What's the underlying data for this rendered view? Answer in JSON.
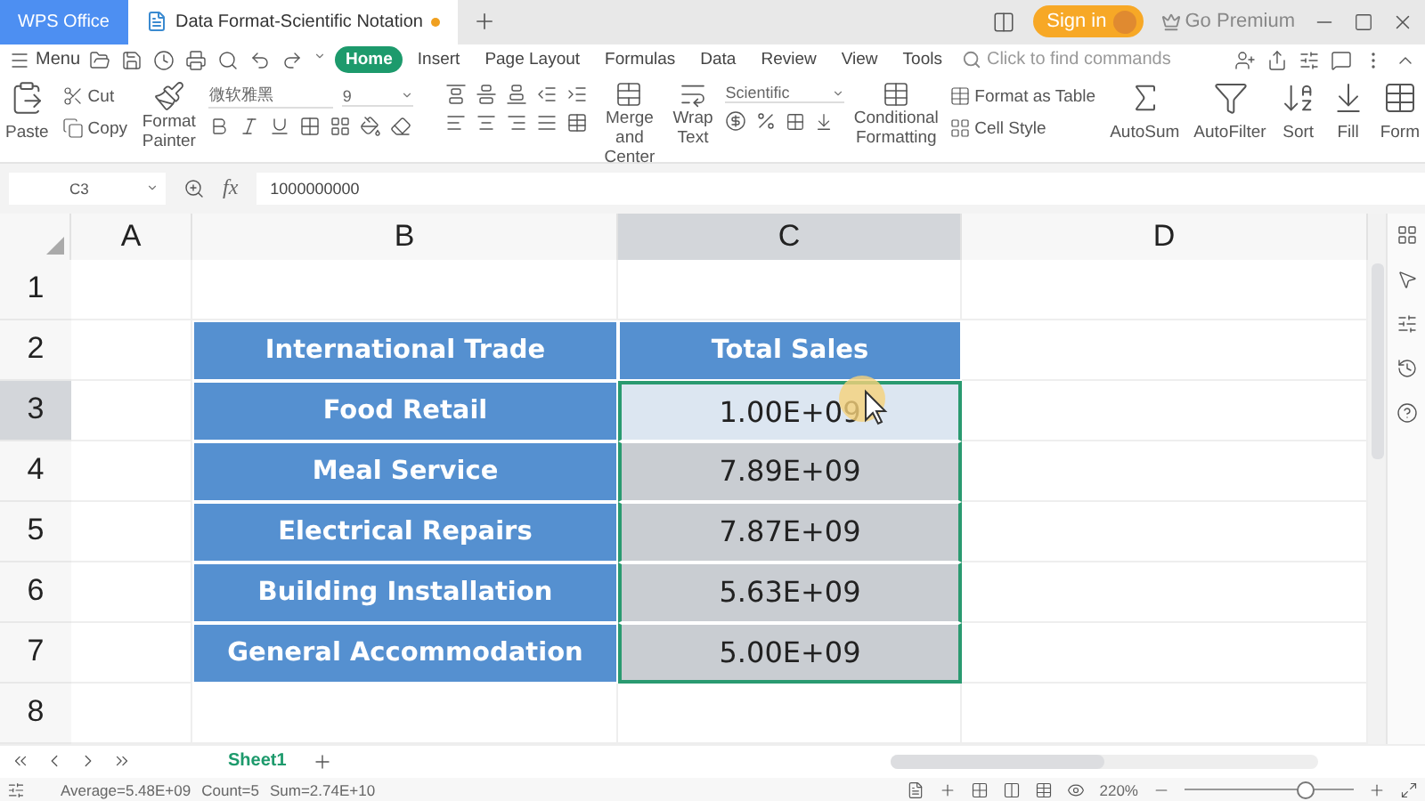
{
  "window": {
    "tabs": [
      {
        "label": "WPS Office",
        "selected": false
      },
      {
        "label": "Data Format-Scientific Notation",
        "selected": true
      }
    ],
    "sign_in": "Sign in",
    "go_premium": "Go Premium"
  },
  "menu": {
    "label": "Menu",
    "tabs": [
      {
        "label": "Home",
        "selected": true
      },
      {
        "label": "Insert",
        "selected": false
      },
      {
        "label": "Page Layout",
        "selected": false
      },
      {
        "label": "Formulas",
        "selected": false
      },
      {
        "label": "Data",
        "selected": false
      },
      {
        "label": "Review",
        "selected": false
      },
      {
        "label": "View",
        "selected": false
      },
      {
        "label": "Tools",
        "selected": false
      }
    ],
    "search": {
      "placeholder": "Click to find commands"
    }
  },
  "ribbon": {
    "paste": "Paste",
    "cut": "Cut",
    "copy": "Copy",
    "format_painter": "Format Painter",
    "font": "微软雅黑",
    "font_size": "9",
    "merge": "Merge and Center",
    "wrap": "Wrap Text",
    "number_format": "Scientific",
    "conditional": "Conditional Formatting",
    "format_table": "Format as Table",
    "cell_style": "Cell Style",
    "autosum": "AutoSum",
    "autofilter": "AutoFilter",
    "sort": "Sort",
    "fill": "Fill",
    "form": "Form"
  },
  "formula_bar": {
    "cell": "C3",
    "fx": "fx",
    "value": "1000000000"
  },
  "sheet": {
    "columns": [
      {
        "label": "A",
        "selected": false
      },
      {
        "label": "B",
        "selected": false
      },
      {
        "label": "C",
        "selected": true
      },
      {
        "label": "D",
        "selected": false
      }
    ],
    "rows": [
      {
        "label": "1",
        "selected": false
      },
      {
        "label": "2",
        "selected": false
      },
      {
        "label": "3",
        "selected": true
      },
      {
        "label": "4",
        "selected": false
      },
      {
        "label": "5",
        "selected": false
      },
      {
        "label": "6",
        "selected": false
      },
      {
        "label": "7",
        "selected": false
      },
      {
        "label": "8",
        "selected": false
      }
    ],
    "table_header": [
      "International Trade",
      "Total Sales"
    ],
    "table_rows": [
      {
        "label": "Food Retail",
        "value": "1.00E+09",
        "selected": true
      },
      {
        "label": "Meal Service",
        "value": "7.89E+09",
        "selected": false
      },
      {
        "label": "Electrical Repairs",
        "value": "7.87E+09",
        "selected": false
      },
      {
        "label": "Building Installation",
        "value": "5.63E+09",
        "selected": false
      },
      {
        "label": "General Accommodation",
        "value": "5.00E+09",
        "selected": false
      }
    ]
  },
  "sheet_tabs": [
    {
      "label": "Sheet1",
      "selected": true
    }
  ],
  "status_bar": {
    "average": "Average=5.48E+09",
    "count": "Count=5",
    "sum": "Sum=2.74E+10",
    "zoom": "220%",
    "zoom_slider": {
      "level": 0.72
    }
  }
}
